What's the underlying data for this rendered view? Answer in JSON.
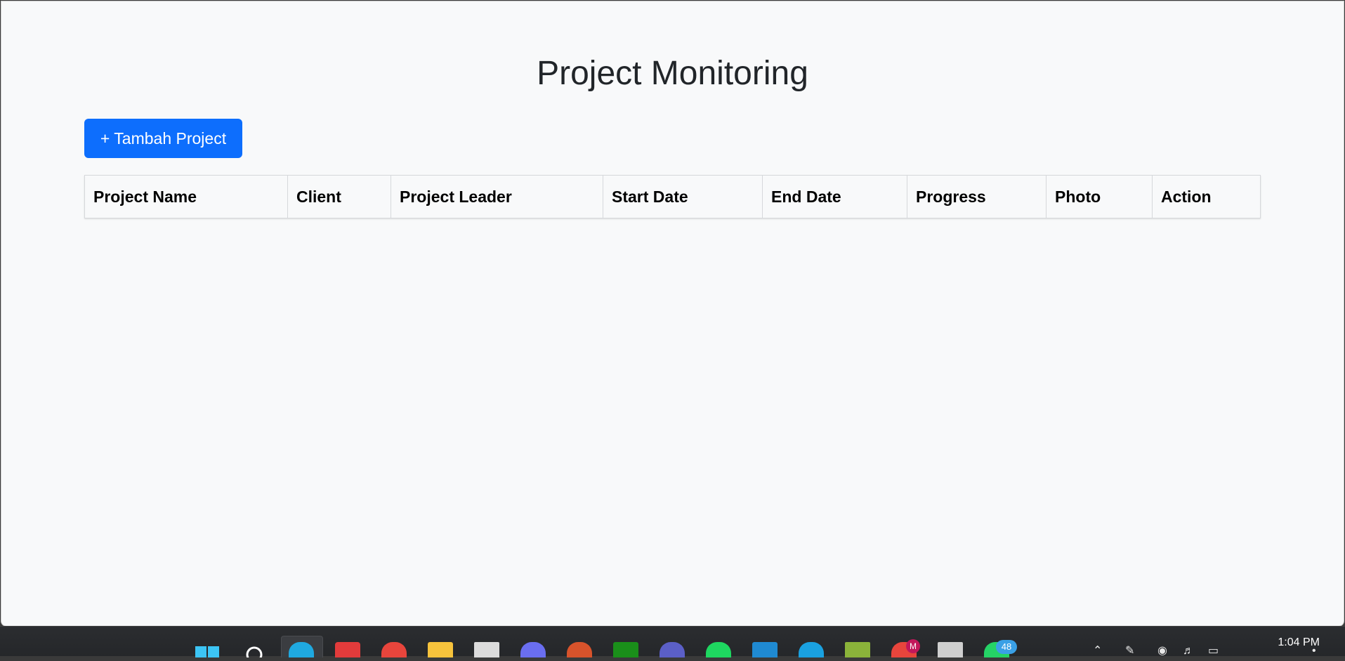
{
  "page": {
    "title": "Project Monitoring",
    "add_button_label": "+ Tambah Project"
  },
  "table": {
    "columns": [
      "Project Name",
      "Client",
      "Project Leader",
      "Start Date",
      "End Date",
      "Progress",
      "Photo",
      "Action"
    ],
    "rows": []
  },
  "taskbar": {
    "time": "1:04 PM",
    "chat_badge": "48",
    "profile_badge": "M",
    "apps": [
      {
        "name": "start-icon",
        "color": "#3cc5f5"
      },
      {
        "name": "search-icon",
        "color": "#ffffff"
      },
      {
        "name": "edge-icon",
        "color": "#1fa9e0"
      },
      {
        "name": "tv-app-icon",
        "color": "#e23b3b"
      },
      {
        "name": "chrome-icon",
        "color": "#e8453c"
      },
      {
        "name": "file-explorer-icon",
        "color": "#f7c33c"
      },
      {
        "name": "notepad-icon",
        "color": "#dcdcdc"
      },
      {
        "name": "copilot-icon",
        "color": "#6a6ef0"
      },
      {
        "name": "powerpoint-icon",
        "color": "#d8532b"
      },
      {
        "name": "xbox-icon",
        "color": "#1a8f1a"
      },
      {
        "name": "teams-icon",
        "color": "#5b5fc7"
      },
      {
        "name": "spotify-icon",
        "color": "#1ed760"
      },
      {
        "name": "vscode-icon",
        "color": "#1f8ad2"
      },
      {
        "name": "cloud-app-icon",
        "color": "#1aa1e0"
      },
      {
        "name": "lambda-app-icon",
        "color": "#8bb33a"
      },
      {
        "name": "chrome-profile-icon",
        "color": "#e8453c"
      },
      {
        "name": "terminal-icon",
        "color": "#cfcfcf"
      },
      {
        "name": "whatsapp-icon",
        "color": "#25d366"
      }
    ]
  }
}
